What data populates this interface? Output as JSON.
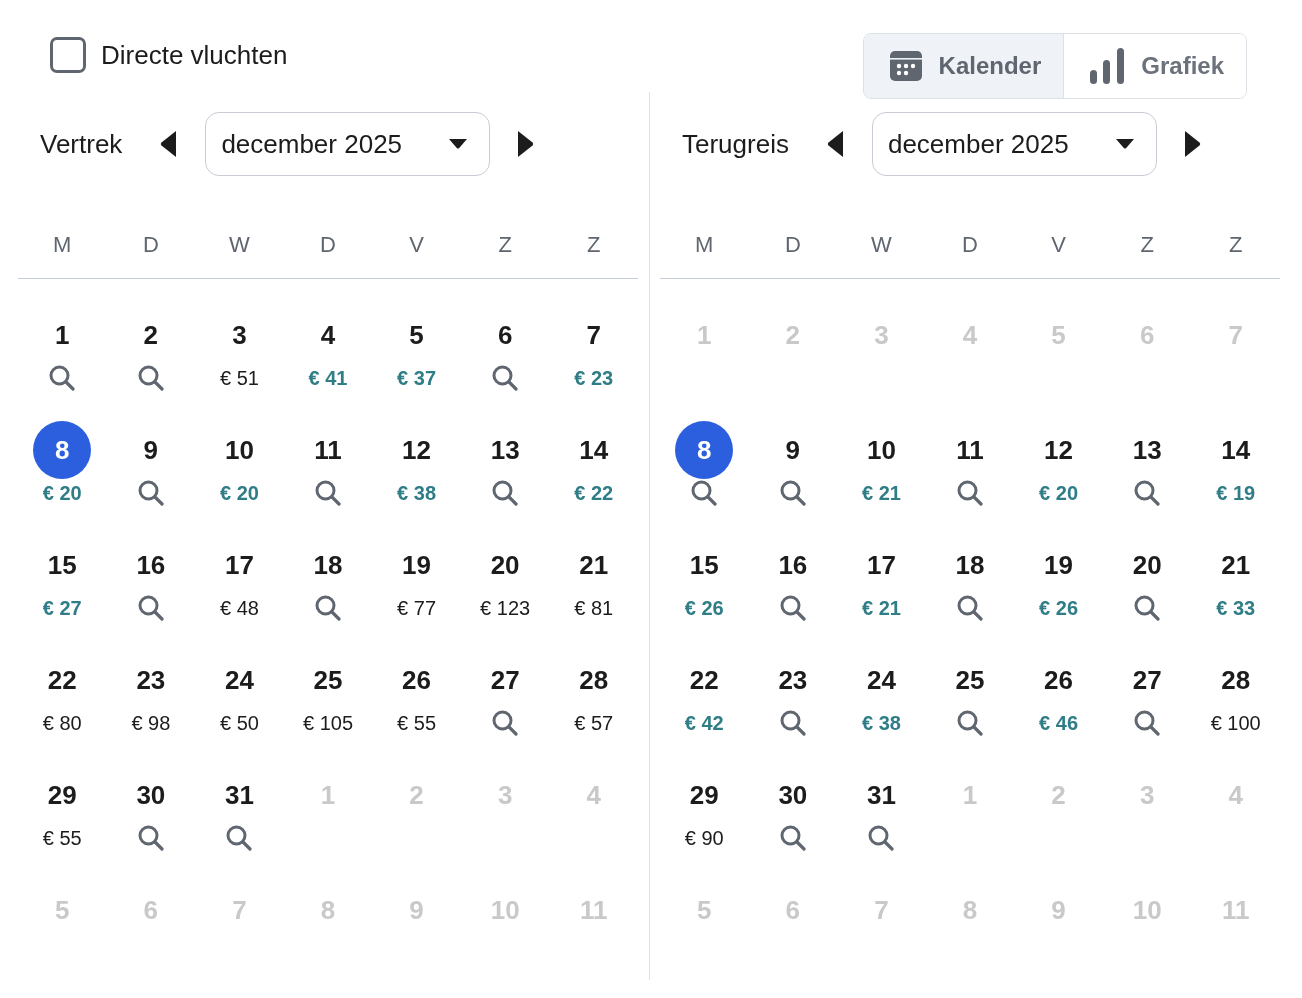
{
  "filters": {
    "direct_flights": {
      "label": "Directe vluchten",
      "checked": false
    }
  },
  "view_toggle": [
    {
      "label": "Kalender",
      "kind": "calendar",
      "selected": true
    },
    {
      "label": "Grafiek",
      "kind": "chart",
      "selected": false
    }
  ],
  "calendars": [
    {
      "label": "Vertrek",
      "month": "december 2025",
      "weekdays": [
        "M",
        "D",
        "W",
        "D",
        "V",
        "Z",
        "Z"
      ],
      "days": [
        {
          "day": "1",
          "selected": false,
          "disabled": false,
          "kind": "search"
        },
        {
          "day": "2",
          "selected": false,
          "disabled": false,
          "kind": "search"
        },
        {
          "day": "3",
          "selected": false,
          "disabled": false,
          "kind": "price",
          "price": "€ 51",
          "cheap": false
        },
        {
          "day": "4",
          "selected": false,
          "disabled": false,
          "kind": "price",
          "price": "€ 41",
          "cheap": true
        },
        {
          "day": "5",
          "selected": false,
          "disabled": false,
          "kind": "price",
          "price": "€ 37",
          "cheap": true
        },
        {
          "day": "6",
          "selected": false,
          "disabled": false,
          "kind": "search"
        },
        {
          "day": "7",
          "selected": false,
          "disabled": false,
          "kind": "price",
          "price": "€ 23",
          "cheap": true
        },
        {
          "day": "8",
          "selected": true,
          "disabled": false,
          "kind": "price",
          "price": "€ 20",
          "cheap": true
        },
        {
          "day": "9",
          "selected": false,
          "disabled": false,
          "kind": "search"
        },
        {
          "day": "10",
          "selected": false,
          "disabled": false,
          "kind": "price",
          "price": "€ 20",
          "cheap": true
        },
        {
          "day": "11",
          "selected": false,
          "disabled": false,
          "kind": "search"
        },
        {
          "day": "12",
          "selected": false,
          "disabled": false,
          "kind": "price",
          "price": "€ 38",
          "cheap": true
        },
        {
          "day": "13",
          "selected": false,
          "disabled": false,
          "kind": "search"
        },
        {
          "day": "14",
          "selected": false,
          "disabled": false,
          "kind": "price",
          "price": "€ 22",
          "cheap": true
        },
        {
          "day": "15",
          "selected": false,
          "disabled": false,
          "kind": "price",
          "price": "€ 27",
          "cheap": true
        },
        {
          "day": "16",
          "selected": false,
          "disabled": false,
          "kind": "search"
        },
        {
          "day": "17",
          "selected": false,
          "disabled": false,
          "kind": "price",
          "price": "€ 48",
          "cheap": false
        },
        {
          "day": "18",
          "selected": false,
          "disabled": false,
          "kind": "search"
        },
        {
          "day": "19",
          "selected": false,
          "disabled": false,
          "kind": "price",
          "price": "€ 77",
          "cheap": false
        },
        {
          "day": "20",
          "selected": false,
          "disabled": false,
          "kind": "price",
          "price": "€ 123",
          "cheap": false
        },
        {
          "day": "21",
          "selected": false,
          "disabled": false,
          "kind": "price",
          "price": "€ 81",
          "cheap": false
        },
        {
          "day": "22",
          "selected": false,
          "disabled": false,
          "kind": "price",
          "price": "€ 80",
          "cheap": false
        },
        {
          "day": "23",
          "selected": false,
          "disabled": false,
          "kind": "price",
          "price": "€ 98",
          "cheap": false
        },
        {
          "day": "24",
          "selected": false,
          "disabled": false,
          "kind": "price",
          "price": "€ 50",
          "cheap": false
        },
        {
          "day": "25",
          "selected": false,
          "disabled": false,
          "kind": "price",
          "price": "€ 105",
          "cheap": false
        },
        {
          "day": "26",
          "selected": false,
          "disabled": false,
          "kind": "price",
          "price": "€ 55",
          "cheap": false
        },
        {
          "day": "27",
          "selected": false,
          "disabled": false,
          "kind": "search"
        },
        {
          "day": "28",
          "selected": false,
          "disabled": false,
          "kind": "price",
          "price": "€ 57",
          "cheap": false
        },
        {
          "day": "29",
          "selected": false,
          "disabled": false,
          "kind": "price",
          "price": "€ 55",
          "cheap": false
        },
        {
          "day": "30",
          "selected": false,
          "disabled": false,
          "kind": "search"
        },
        {
          "day": "31",
          "selected": false,
          "disabled": false,
          "kind": "search"
        },
        {
          "day": "1",
          "selected": false,
          "disabled": true,
          "kind": "blank"
        },
        {
          "day": "2",
          "selected": false,
          "disabled": true,
          "kind": "blank"
        },
        {
          "day": "3",
          "selected": false,
          "disabled": true,
          "kind": "blank"
        },
        {
          "day": "4",
          "selected": false,
          "disabled": true,
          "kind": "blank"
        },
        {
          "day": "5",
          "selected": false,
          "disabled": true,
          "kind": "blank"
        },
        {
          "day": "6",
          "selected": false,
          "disabled": true,
          "kind": "blank"
        },
        {
          "day": "7",
          "selected": false,
          "disabled": true,
          "kind": "blank"
        },
        {
          "day": "8",
          "selected": false,
          "disabled": true,
          "kind": "blank"
        },
        {
          "day": "9",
          "selected": false,
          "disabled": true,
          "kind": "blank"
        },
        {
          "day": "10",
          "selected": false,
          "disabled": true,
          "kind": "blank"
        },
        {
          "day": "11",
          "selected": false,
          "disabled": true,
          "kind": "blank"
        }
      ]
    },
    {
      "label": "Terugreis",
      "month": "december 2025",
      "weekdays": [
        "M",
        "D",
        "W",
        "D",
        "V",
        "Z",
        "Z"
      ],
      "days": [
        {
          "day": "1",
          "selected": false,
          "disabled": true,
          "kind": "blank"
        },
        {
          "day": "2",
          "selected": false,
          "disabled": true,
          "kind": "blank"
        },
        {
          "day": "3",
          "selected": false,
          "disabled": true,
          "kind": "blank"
        },
        {
          "day": "4",
          "selected": false,
          "disabled": true,
          "kind": "blank"
        },
        {
          "day": "5",
          "selected": false,
          "disabled": true,
          "kind": "blank"
        },
        {
          "day": "6",
          "selected": false,
          "disabled": true,
          "kind": "blank"
        },
        {
          "day": "7",
          "selected": false,
          "disabled": true,
          "kind": "blank"
        },
        {
          "day": "8",
          "selected": true,
          "disabled": false,
          "kind": "search"
        },
        {
          "day": "9",
          "selected": false,
          "disabled": false,
          "kind": "search"
        },
        {
          "day": "10",
          "selected": false,
          "disabled": false,
          "kind": "price",
          "price": "€ 21",
          "cheap": true
        },
        {
          "day": "11",
          "selected": false,
          "disabled": false,
          "kind": "search"
        },
        {
          "day": "12",
          "selected": false,
          "disabled": false,
          "kind": "price",
          "price": "€ 20",
          "cheap": true
        },
        {
          "day": "13",
          "selected": false,
          "disabled": false,
          "kind": "search"
        },
        {
          "day": "14",
          "selected": false,
          "disabled": false,
          "kind": "price",
          "price": "€ 19",
          "cheap": true
        },
        {
          "day": "15",
          "selected": false,
          "disabled": false,
          "kind": "price",
          "price": "€ 26",
          "cheap": true
        },
        {
          "day": "16",
          "selected": false,
          "disabled": false,
          "kind": "search"
        },
        {
          "day": "17",
          "selected": false,
          "disabled": false,
          "kind": "price",
          "price": "€ 21",
          "cheap": true
        },
        {
          "day": "18",
          "selected": false,
          "disabled": false,
          "kind": "search"
        },
        {
          "day": "19",
          "selected": false,
          "disabled": false,
          "kind": "price",
          "price": "€ 26",
          "cheap": true
        },
        {
          "day": "20",
          "selected": false,
          "disabled": false,
          "kind": "search"
        },
        {
          "day": "21",
          "selected": false,
          "disabled": false,
          "kind": "price",
          "price": "€ 33",
          "cheap": true
        },
        {
          "day": "22",
          "selected": false,
          "disabled": false,
          "kind": "price",
          "price": "€ 42",
          "cheap": true
        },
        {
          "day": "23",
          "selected": false,
          "disabled": false,
          "kind": "search"
        },
        {
          "day": "24",
          "selected": false,
          "disabled": false,
          "kind": "price",
          "price": "€ 38",
          "cheap": true
        },
        {
          "day": "25",
          "selected": false,
          "disabled": false,
          "kind": "search"
        },
        {
          "day": "26",
          "selected": false,
          "disabled": false,
          "kind": "price",
          "price": "€ 46",
          "cheap": true
        },
        {
          "day": "27",
          "selected": false,
          "disabled": false,
          "kind": "search"
        },
        {
          "day": "28",
          "selected": false,
          "disabled": false,
          "kind": "price",
          "price": "€ 100",
          "cheap": false
        },
        {
          "day": "29",
          "selected": false,
          "disabled": false,
          "kind": "price",
          "price": "€ 90",
          "cheap": false
        },
        {
          "day": "30",
          "selected": false,
          "disabled": false,
          "kind": "search"
        },
        {
          "day": "31",
          "selected": false,
          "disabled": false,
          "kind": "search"
        },
        {
          "day": "1",
          "selected": false,
          "disabled": true,
          "kind": "blank"
        },
        {
          "day": "2",
          "selected": false,
          "disabled": true,
          "kind": "blank"
        },
        {
          "day": "3",
          "selected": false,
          "disabled": true,
          "kind": "blank"
        },
        {
          "day": "4",
          "selected": false,
          "disabled": true,
          "kind": "blank"
        },
        {
          "day": "5",
          "selected": false,
          "disabled": true,
          "kind": "blank"
        },
        {
          "day": "6",
          "selected": false,
          "disabled": true,
          "kind": "blank"
        },
        {
          "day": "7",
          "selected": false,
          "disabled": true,
          "kind": "blank"
        },
        {
          "day": "8",
          "selected": false,
          "disabled": true,
          "kind": "blank"
        },
        {
          "day": "9",
          "selected": false,
          "disabled": true,
          "kind": "blank"
        },
        {
          "day": "10",
          "selected": false,
          "disabled": true,
          "kind": "blank"
        },
        {
          "day": "11",
          "selected": false,
          "disabled": true,
          "kind": "blank"
        }
      ]
    }
  ]
}
